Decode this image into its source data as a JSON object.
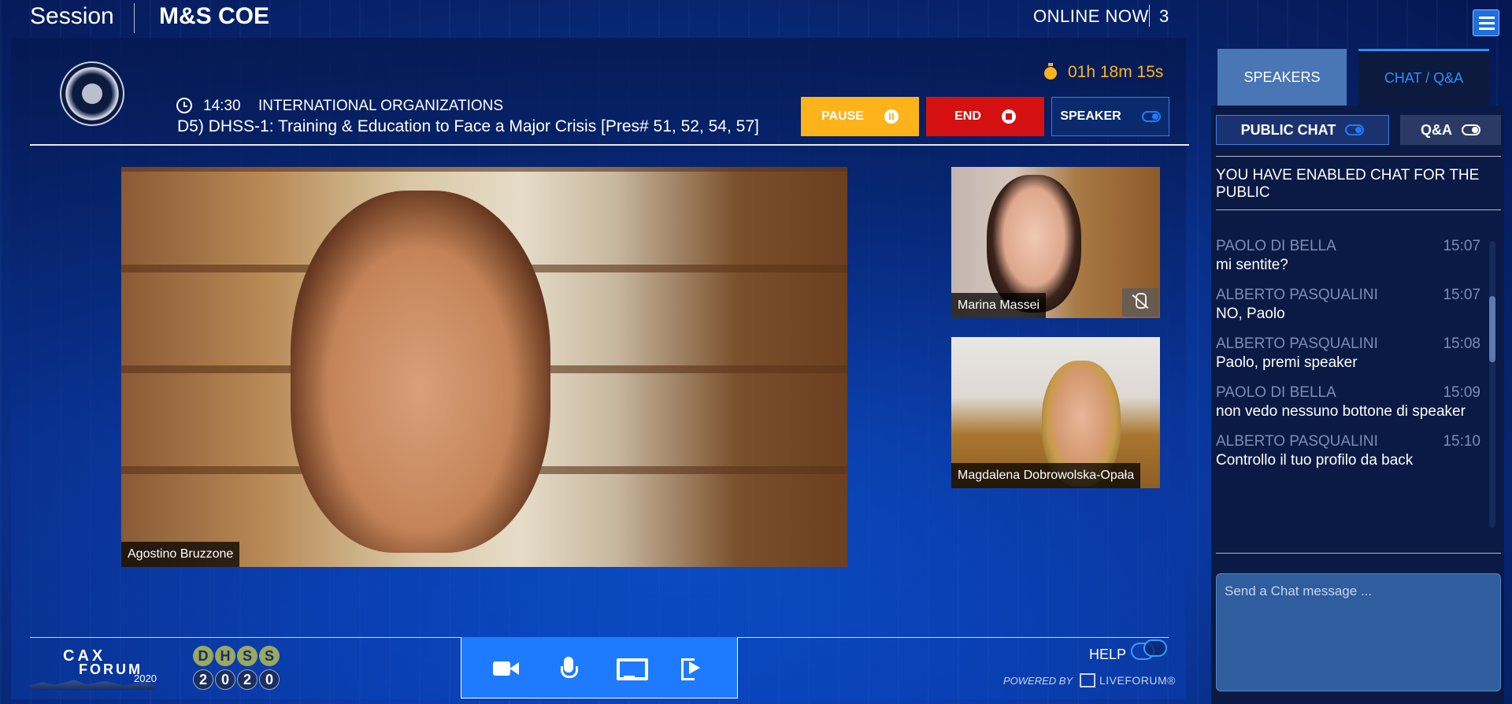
{
  "top": {
    "session_label": "Session",
    "org_name": "M&S COE",
    "online_label": "ONLINE NOW",
    "online_count": "3"
  },
  "session": {
    "time": "14:30",
    "category": "INTERNATIONAL ORGANIZATIONS",
    "title": "D5) DHSS-1: Training & Education to Face a Major Crisis [Pres# 51, 52, 54, 57]",
    "timer": "01h 18m 15s"
  },
  "controls": {
    "pause_label": "PAUSE",
    "end_label": "END",
    "speaker_label": "SPEAKER"
  },
  "videos": {
    "main_name": "Agostino Bruzzone",
    "small": [
      {
        "name": "Marina Massei",
        "muted": true
      },
      {
        "name": "Magdalena Dobrowolska-Opała",
        "muted": false
      }
    ]
  },
  "footer": {
    "cax_top": "CAX",
    "cax_forum": "FORUM",
    "cax_year": "2020",
    "dhss_top": [
      "D",
      "H",
      "S",
      "S"
    ],
    "dhss_bottom": [
      "2",
      "0",
      "2",
      "0"
    ],
    "help": "HELP",
    "powered_by": "POWERED BY",
    "liveforum": "LIVEFORUM®"
  },
  "panel": {
    "tabs": [
      {
        "label": "SPEAKERS",
        "active": false
      },
      {
        "label": "CHAT / Q&A",
        "active": true
      }
    ],
    "public_chat_label": "PUBLIC CHAT",
    "qa_label": "Q&A",
    "notice": "YOU HAVE ENABLED CHAT FOR THE PUBLIC",
    "messages": [
      {
        "author": "PAOLO DI BELLA",
        "time": "15:07",
        "text": "mi sentite?"
      },
      {
        "author": "ALBERTO PASQUALINI",
        "time": "15:07",
        "text": "NO, Paolo"
      },
      {
        "author": "ALBERTO PASQUALINI",
        "time": "15:08",
        "text": "Paolo, premi speaker"
      },
      {
        "author": "PAOLO DI BELLA",
        "time": "15:09",
        "text": "non vedo nessuno bottone di speaker"
      },
      {
        "author": "ALBERTO PASQUALINI",
        "time": "15:10",
        "text": "Controllo il tuo profilo da back"
      }
    ],
    "input_placeholder": "Send a Chat message ..."
  },
  "colors": {
    "accent": "#1e7bff",
    "pause": "#ffb31a",
    "end": "#d51010",
    "timer": "#ffb31a"
  }
}
